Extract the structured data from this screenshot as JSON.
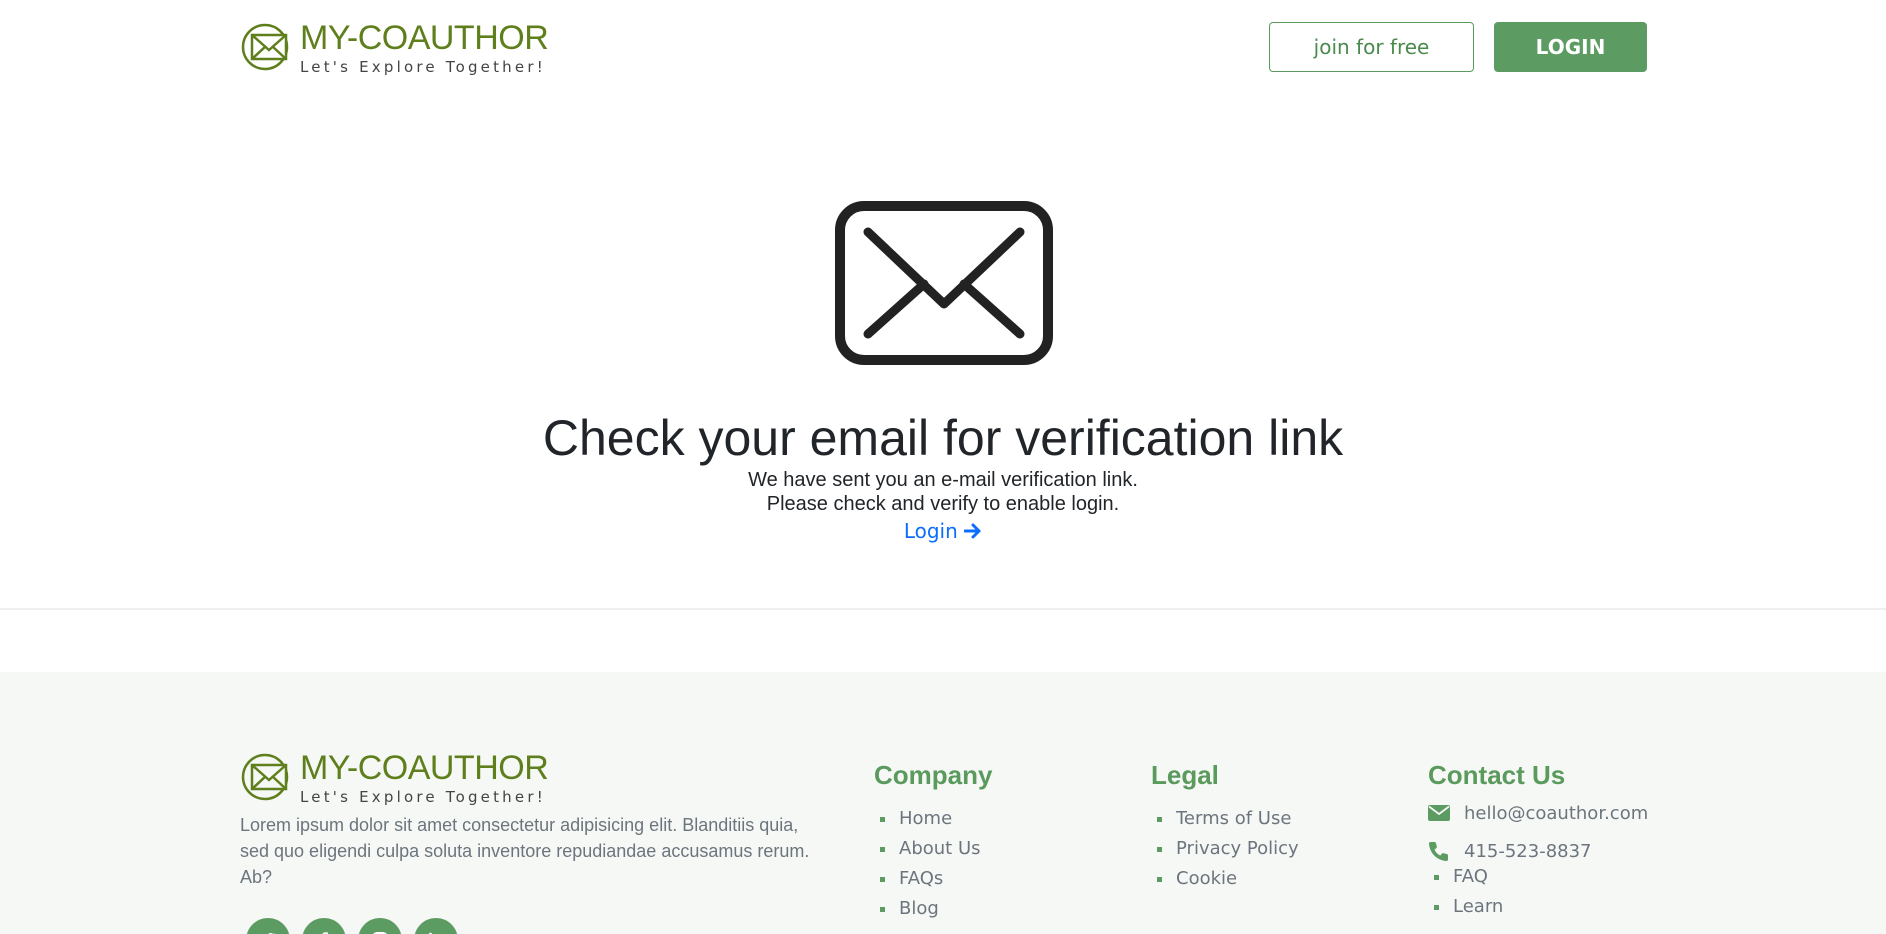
{
  "brand": {
    "name": "MY-COAUTHOR",
    "tagline": "Let's Explore Together!"
  },
  "header": {
    "join_label": "join for free",
    "login_label": "LOGIN"
  },
  "main": {
    "icon": "envelope-icon",
    "headline": "Check your email for verification link",
    "line1": "We have sent you an e-mail verification link.",
    "line2": "Please check and verify to enable login.",
    "login_link": "Login"
  },
  "footer": {
    "description": "Lorem ipsum dolor sit amet consectetur adipisicing elit. Blanditiis quia, sed quo eligendi culpa soluta inventore repudiandae accusamus rerum. Ab?",
    "socials": [
      "twitter-icon",
      "facebook-icon",
      "instagram-icon",
      "linkedin-icon"
    ],
    "company": {
      "title": "Company",
      "items": [
        "Home",
        "About Us",
        "FAQs",
        "Blog"
      ]
    },
    "legal": {
      "title": "Legal",
      "items": [
        "Terms of Use",
        "Privacy Policy",
        "Cookie"
      ]
    },
    "contact": {
      "title": "Contact Us",
      "email": "hello@coauthor.com",
      "phone": "415-523-8837",
      "items": [
        "FAQ",
        "Learn"
      ]
    }
  },
  "colors": {
    "brand_green": "#5f7f1d",
    "accent_green": "#5c9c62",
    "link_blue": "#0d6efd"
  }
}
